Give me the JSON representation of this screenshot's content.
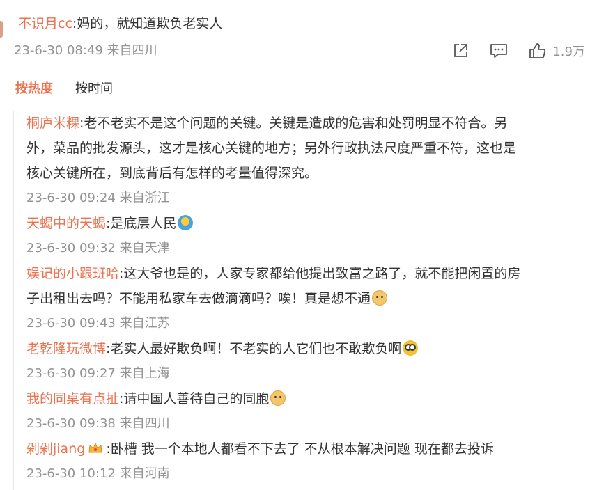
{
  "main_comment": {
    "user": "不识月cc",
    "separator": ":",
    "text": "妈的，就知道欺负老实人",
    "timestamp": "23-6-30 08:49 来自四川",
    "like_count": "1.9万"
  },
  "sort_tabs": {
    "hot": "按热度",
    "time": "按时间"
  },
  "replies": [
    {
      "user": "桐庐米粿",
      "text": "老不老实不是这个问题的关键。关键是造成的危害和处罚明显不符合。另",
      "text2": "外，菜品的批发源头，这才是核心关键的地方；另外行政执法尺度严重不符，这也是",
      "text3": "核心关键所在，到底背后有怎样的考量值得深究。",
      "time": "23-6-30 09:24 来自浙江"
    },
    {
      "user": "天蝎中的天蝎",
      "text": "是底层人民",
      "emoji": "shrug-icon",
      "time": "23-6-30 09:32 来自天津"
    },
    {
      "user": "娱记的小跟班哈",
      "text": "这大爷也是的，人家专家都给他提出致富之路了，就不能把闲置的房",
      "text2": "子出租出去吗？不能用私家车去做滴滴吗？唉！真是想不通",
      "emoji": "doge-icon",
      "time": "23-6-30 09:43 来自江苏"
    },
    {
      "user": "老乾隆玩微博",
      "text": "老实人最好欺负啊！不老实的人它们也不敢欺负啊",
      "emoji": "shocked-face-icon",
      "time": "23-6-30 09:27 来自上海"
    },
    {
      "user": "我的同桌有点扯",
      "text": "请中国人善待自己的同胞",
      "emoji": "doge-icon",
      "time": "23-6-30 09:38 来自四川"
    },
    {
      "user": "剁剁jiang",
      "badge": "crown-badge-icon",
      "text": "卧槽  我一个本地人都看不下去了 不从根本解决问题 现在都去投诉",
      "time": "23-6-30 10:12 来自河南"
    }
  ],
  "colors": {
    "username": "#eb7350",
    "meta": "#939393",
    "text": "#333333",
    "divider": "#e6e6e6"
  }
}
